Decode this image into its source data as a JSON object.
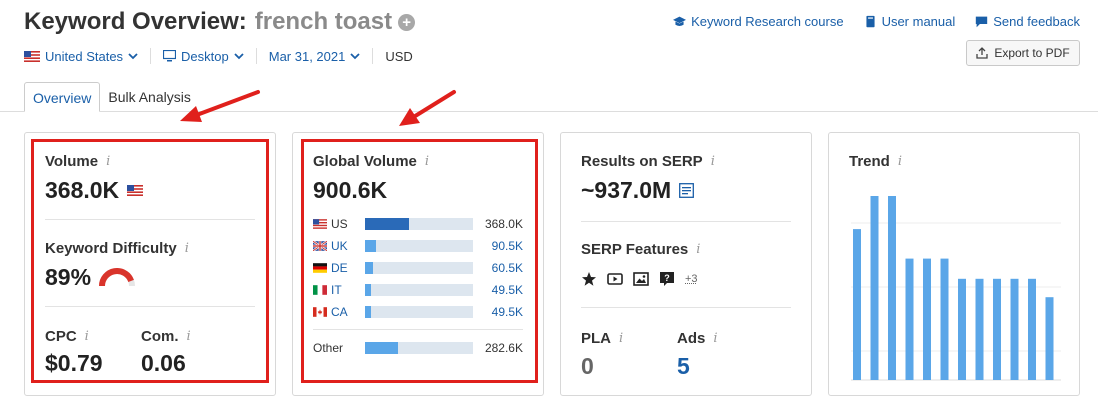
{
  "header": {
    "title": "Keyword Overview:",
    "keyword": "french toast",
    "links": [
      {
        "label": "Keyword Research course",
        "icon": "graduation-cap-icon"
      },
      {
        "label": "User manual",
        "icon": "book-icon"
      },
      {
        "label": "Send feedback",
        "icon": "chat-bubble-icon"
      }
    ],
    "export_label": "Export to PDF"
  },
  "filters": {
    "country": "United States",
    "device": "Desktop",
    "date": "Mar 31, 2021",
    "currency": "USD"
  },
  "tabs": [
    {
      "label": "Overview",
      "active": true
    },
    {
      "label": "Bulk Analysis",
      "active": false
    }
  ],
  "volume": {
    "label": "Volume",
    "value": "368.0K"
  },
  "difficulty": {
    "label": "Keyword Difficulty",
    "value": "89%",
    "percent": 89
  },
  "cpc": {
    "label": "CPC",
    "value": "$0.79"
  },
  "competition": {
    "label": "Com.",
    "value": "0.06"
  },
  "global": {
    "label": "Global Volume",
    "value": "900.6K",
    "countries": [
      {
        "code": "US",
        "value": "368.0K",
        "fraction": 0.41
      },
      {
        "code": "UK",
        "value": "90.5K",
        "fraction": 0.1
      },
      {
        "code": "DE",
        "value": "60.5K",
        "fraction": 0.07
      },
      {
        "code": "IT",
        "value": "49.5K",
        "fraction": 0.06
      },
      {
        "code": "CA",
        "value": "49.5K",
        "fraction": 0.06
      }
    ],
    "other": {
      "label": "Other",
      "value": "282.6K",
      "fraction": 0.31
    }
  },
  "serp": {
    "results_label": "Results on SERP",
    "results_value": "~937.0M",
    "features_label": "SERP Features",
    "features": [
      "star-icon",
      "video-icon",
      "image-icon",
      "question-icon"
    ],
    "more": "+3",
    "pla_label": "PLA",
    "pla_value": "0",
    "ads_label": "Ads",
    "ads_value": "5"
  },
  "trend": {
    "label": "Trend",
    "values": [
      0.82,
      1.0,
      1.0,
      0.66,
      0.66,
      0.66,
      0.55,
      0.55,
      0.55,
      0.55,
      0.55,
      0.45
    ]
  },
  "colors": {
    "accent": "#1a5fa8",
    "bar": "#5aa6e8",
    "bar_dark": "#2a6ab8",
    "annotation": "#e0201c",
    "difficulty_arc": "#d9342b"
  }
}
